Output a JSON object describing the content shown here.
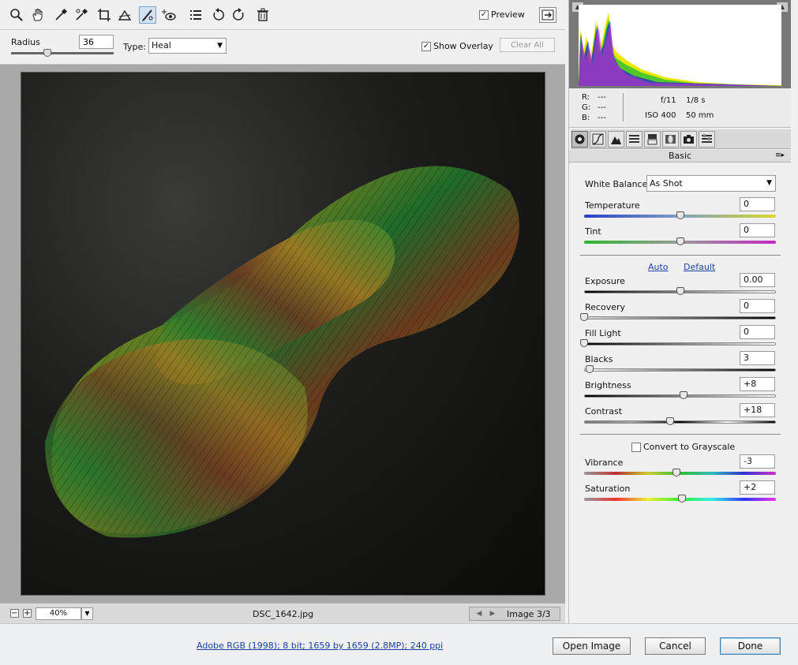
{
  "toolbar": {
    "tools": [
      {
        "name": "zoom-icon"
      },
      {
        "name": "hand-icon"
      },
      {
        "name": "white-balance-icon"
      },
      {
        "name": "color-sampler-icon"
      },
      {
        "name": "crop-icon"
      },
      {
        "name": "straighten-icon"
      },
      {
        "name": "spot-removal-icon"
      },
      {
        "name": "red-eye-icon"
      },
      {
        "name": "preferences-icon"
      },
      {
        "name": "rotate-left-icon"
      },
      {
        "name": "rotate-right-icon"
      },
      {
        "name": "trash-icon"
      }
    ],
    "active_tool": "spot-removal-icon",
    "preview_label": "Preview",
    "preview_checked": true
  },
  "options": {
    "radius_label": "Radius",
    "radius_value": "36",
    "type_label": "Type:",
    "type_value": "Heal",
    "show_overlay_label": "Show Overlay",
    "show_overlay_checked": true,
    "clear_all_label": "Clear All"
  },
  "statusbar": {
    "zoom": "40%",
    "filename": "DSC_1642.jpg",
    "image_count": "Image 3/3"
  },
  "readout": {
    "r_label": "R:",
    "r_value": "---",
    "g_label": "G:",
    "g_value": "---",
    "b_label": "B:",
    "b_value": "---",
    "aperture": "f/11",
    "shutter": "1/8 s",
    "iso": "ISO 400",
    "focal": "50 mm"
  },
  "panel": {
    "title": "Basic",
    "white_balance_label": "White Balance:",
    "white_balance_value": "As Shot",
    "auto_label": "Auto",
    "default_label": "Default",
    "grayscale_label": "Convert to Grayscale",
    "grayscale_checked": false,
    "sliders": {
      "temperature": {
        "label": "Temperature",
        "value": "0",
        "level": 0.5
      },
      "tint": {
        "label": "Tint",
        "value": "0",
        "level": 0.5
      },
      "exposure": {
        "label": "Exposure",
        "value": "0.00",
        "level": 0.5
      },
      "recovery": {
        "label": "Recovery",
        "value": "0",
        "level": 0.0
      },
      "fill_light": {
        "label": "Fill Light",
        "value": "0",
        "level": 0.0
      },
      "blacks": {
        "label": "Blacks",
        "value": "3",
        "level": 0.03
      },
      "brightness": {
        "label": "Brightness",
        "value": "+8",
        "level": 0.52
      },
      "contrast": {
        "label": "Contrast",
        "value": "+18",
        "level": 0.45
      },
      "vibrance": {
        "label": "Vibrance",
        "value": "-3",
        "level": 0.48
      },
      "saturation": {
        "label": "Saturation",
        "value": "+2",
        "level": 0.51
      }
    }
  },
  "footer": {
    "file_info": "Adobe RGB (1998); 8 bit; 1659 by 1659 (2.8MP); 240 ppi",
    "open_image_label": "Open Image",
    "cancel_label": "Cancel",
    "done_label": "Done"
  },
  "colors": {
    "selection_blue": "#cfe2f6",
    "link_blue": "#1f43a5",
    "histogram_bg": "#787878",
    "canvas_bg": "#a9a9a9"
  }
}
